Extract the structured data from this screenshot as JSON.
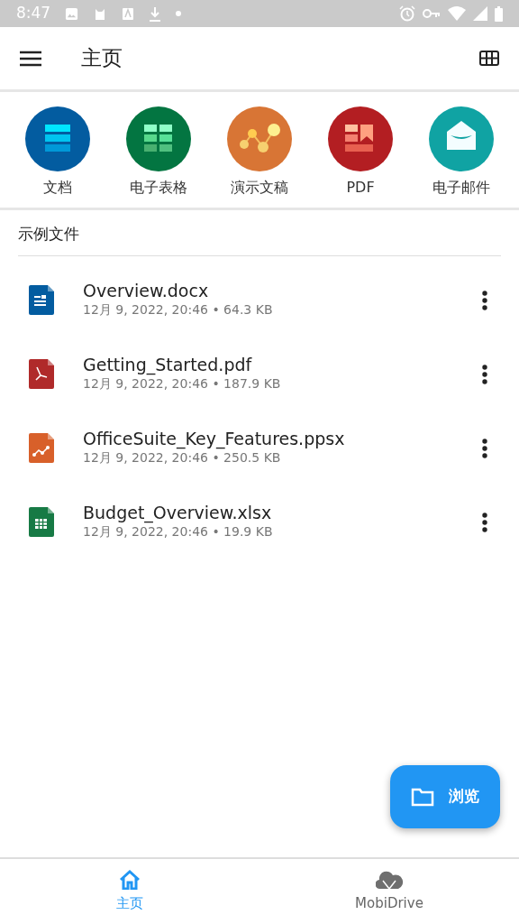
{
  "status_bar": {
    "time": "8:47"
  },
  "app_bar": {
    "title": "主页"
  },
  "shortcuts": [
    {
      "kind": "doc",
      "label": "文档"
    },
    {
      "kind": "sheet",
      "label": "电子表格"
    },
    {
      "kind": "slides",
      "label": "演示文稿"
    },
    {
      "kind": "pdf",
      "label": "PDF"
    },
    {
      "kind": "email",
      "label": "电子邮件"
    }
  ],
  "section": {
    "title": "示例文件"
  },
  "files": [
    {
      "kind": "doc",
      "name": "Overview.docx",
      "details": "12月 9, 2022, 20:46 • 64.3 KB"
    },
    {
      "kind": "pdf",
      "name": "Getting_Started.pdf",
      "details": "12月 9, 2022, 20:46 • 187.9 KB"
    },
    {
      "kind": "slides",
      "name": "OfficeSuite_Key_Features.ppsx",
      "details": "12月 9, 2022, 20:46 • 250.5 KB"
    },
    {
      "kind": "sheet",
      "name": "Budget_Overview.xlsx",
      "details": "12月 9, 2022, 20:46 • 19.9 KB"
    }
  ],
  "fab": {
    "label": "浏览"
  },
  "bottom_nav": [
    {
      "kind": "home",
      "label": "主页",
      "selected": true
    },
    {
      "kind": "cloud",
      "label": "MobiDrive",
      "selected": false
    }
  ]
}
